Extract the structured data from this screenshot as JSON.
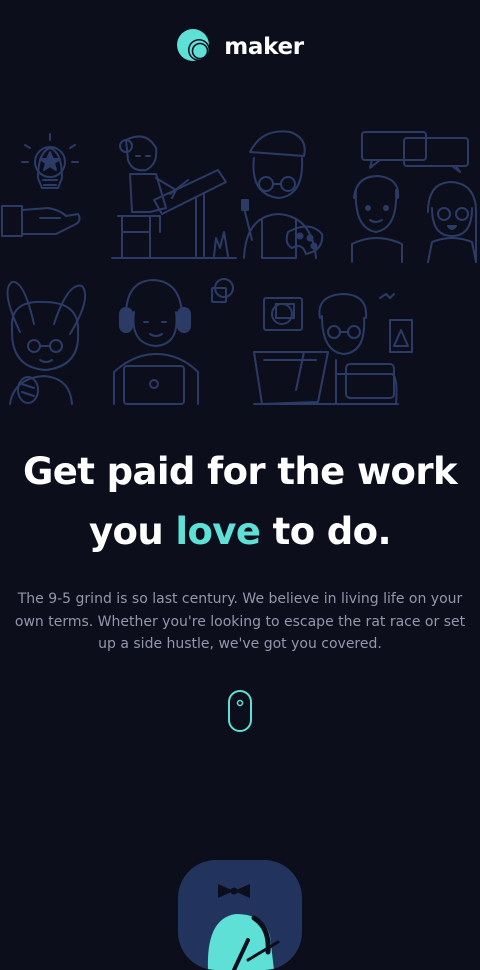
{
  "brand": {
    "name": "maker",
    "accent_color": "#5fe0d7",
    "background_color": "#0c0e1c",
    "illustration_color": "#2b3b66",
    "logo_icon": "maker-logo-icon"
  },
  "hero": {
    "title_line1": "Get paid for the work",
    "title_line2_before": "you ",
    "title_highlight": "love",
    "title_line2_after": " to do.",
    "subtitle": "The 9-5 grind is so last century. We believe in living life on your own terms. Whether you're looking to escape the rat race or set up a side hustle, we've got you covered."
  },
  "illustrations": [
    "idea-hand-icon",
    "drafting-table-person-icon",
    "painter-person-icon",
    "chatting-people-icon",
    "bunny-ears-person-icon",
    "laptop-headphones-person-icon",
    "tablet-designer-person-icon"
  ],
  "scroll": {
    "icon": "mouse-scroll-icon"
  },
  "bottom_card": {
    "icon": "bowtie-person-icon"
  }
}
